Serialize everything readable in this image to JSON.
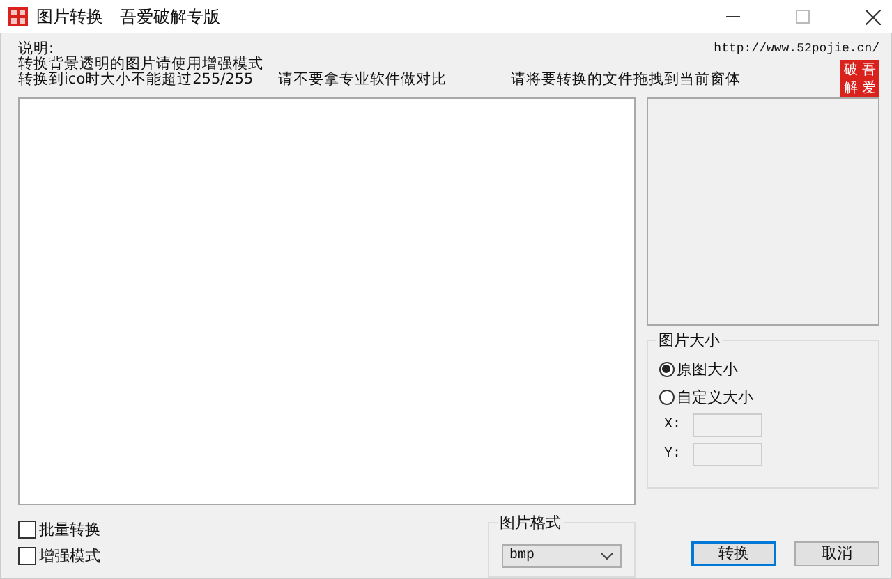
{
  "window": {
    "title": "图片转换",
    "subtitle": "吾爱破解专版"
  },
  "info": {
    "lines": [
      "说明:",
      "转换背景透明的图片请使用增强模式"
    ],
    "notes": [
      "转换到ico时大小不能超过255/255",
      "请不要拿专业软件做对比",
      "请将要转换的文件拖拽到当前窗体"
    ],
    "url": "http://www.52pojie.cn/",
    "logo": [
      "破",
      "吾",
      "解",
      "爱"
    ]
  },
  "size_group": {
    "title": "图片大小",
    "options": [
      {
        "label": "原图大小",
        "selected": true
      },
      {
        "label": "自定义大小",
        "selected": false
      }
    ],
    "fields": [
      {
        "label": "X:"
      },
      {
        "label": "Y:"
      }
    ]
  },
  "options": [
    {
      "label": "批量转换",
      "checked": false
    },
    {
      "label": "增强模式",
      "checked": false
    }
  ],
  "format": {
    "title": "图片格式",
    "value": "bmp"
  },
  "buttons": [
    {
      "label": "转换",
      "default": true
    },
    {
      "label": "取消",
      "default": false
    }
  ]
}
